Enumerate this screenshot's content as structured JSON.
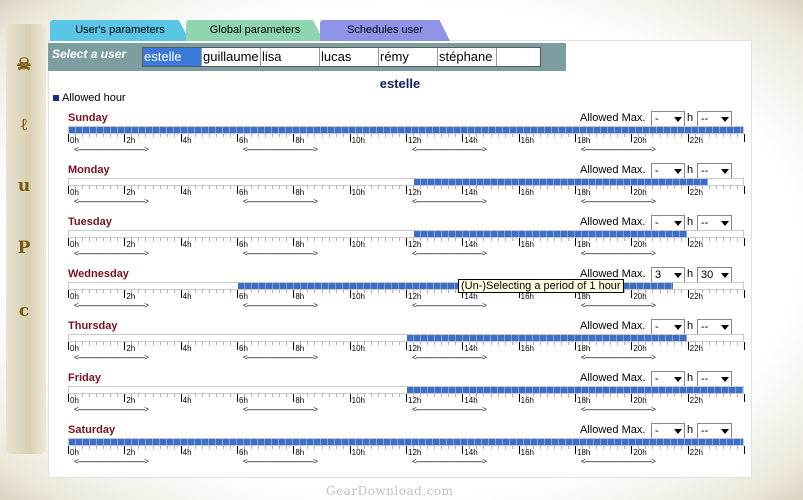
{
  "tabs": [
    {
      "label": "User's parameters",
      "color": "#59c6e6"
    },
    {
      "label": "Global parameters",
      "color": "#8fd6b0"
    },
    {
      "label": "Schedules user",
      "color": "#8e93e8"
    }
  ],
  "select_user": {
    "label": "Select a user",
    "users": [
      "estelle",
      "guillaume",
      "lisa",
      "lucas",
      "rémy",
      "stéphane",
      ""
    ],
    "selected": "estelle"
  },
  "page_title": "estelle",
  "legend": {
    "label": "Allowed hour",
    "color": "#1a2e8a"
  },
  "colors": {
    "allowed": "#3c6fc8",
    "track_bg": "#ffffff",
    "day_name": "#7a1020"
  },
  "hour_labels": [
    "0h",
    "2h",
    "4h",
    "6h",
    "8h",
    "10h",
    "12h",
    "14h",
    "16h",
    "18h",
    "20h",
    "22h"
  ],
  "arrow_text": "<-----------------------------",
  "days": [
    {
      "name": "Sunday",
      "allowed_label": "Allowed Max.",
      "max_hours": "-",
      "h_label": "h",
      "max_minutes": "--",
      "allowed_from": 0,
      "allowed_to": 24
    },
    {
      "name": "Monday",
      "allowed_label": "Allowed Max.",
      "max_hours": "-",
      "h_label": "h",
      "max_minutes": "--",
      "allowed_from": 12.25,
      "allowed_to": 22.75
    },
    {
      "name": "Tuesday",
      "allowed_label": "Allowed Max.",
      "max_hours": "-",
      "h_label": "h",
      "max_minutes": "--",
      "allowed_from": 12.25,
      "allowed_to": 22
    },
    {
      "name": "Wednesday",
      "allowed_label": "Allowed Max.",
      "max_hours": "3",
      "h_label": "h",
      "max_minutes": "30",
      "allowed_from": 6,
      "allowed_to": 21.5
    },
    {
      "name": "Thursday",
      "allowed_label": "Allowed Max.",
      "max_hours": "-",
      "h_label": "h",
      "max_minutes": "--",
      "allowed_from": 12,
      "allowed_to": 22
    },
    {
      "name": "Friday",
      "allowed_label": "Allowed Max.",
      "max_hours": "-",
      "h_label": "h",
      "max_minutes": "--",
      "allowed_from": 12,
      "allowed_to": 24
    },
    {
      "name": "Saturday",
      "allowed_label": "Allowed Max.",
      "max_hours": "-",
      "h_label": "h",
      "max_minutes": "--",
      "allowed_from": 0,
      "allowed_to": 24
    }
  ],
  "tooltip": "(Un-)Selecting a period of 1 hour",
  "watermark": "GearDownload.com",
  "side_icons": [
    "skull-icon",
    "letter-e-icon",
    "letter-u-icon",
    "letter-p-icon",
    "letter-c-icon"
  ]
}
